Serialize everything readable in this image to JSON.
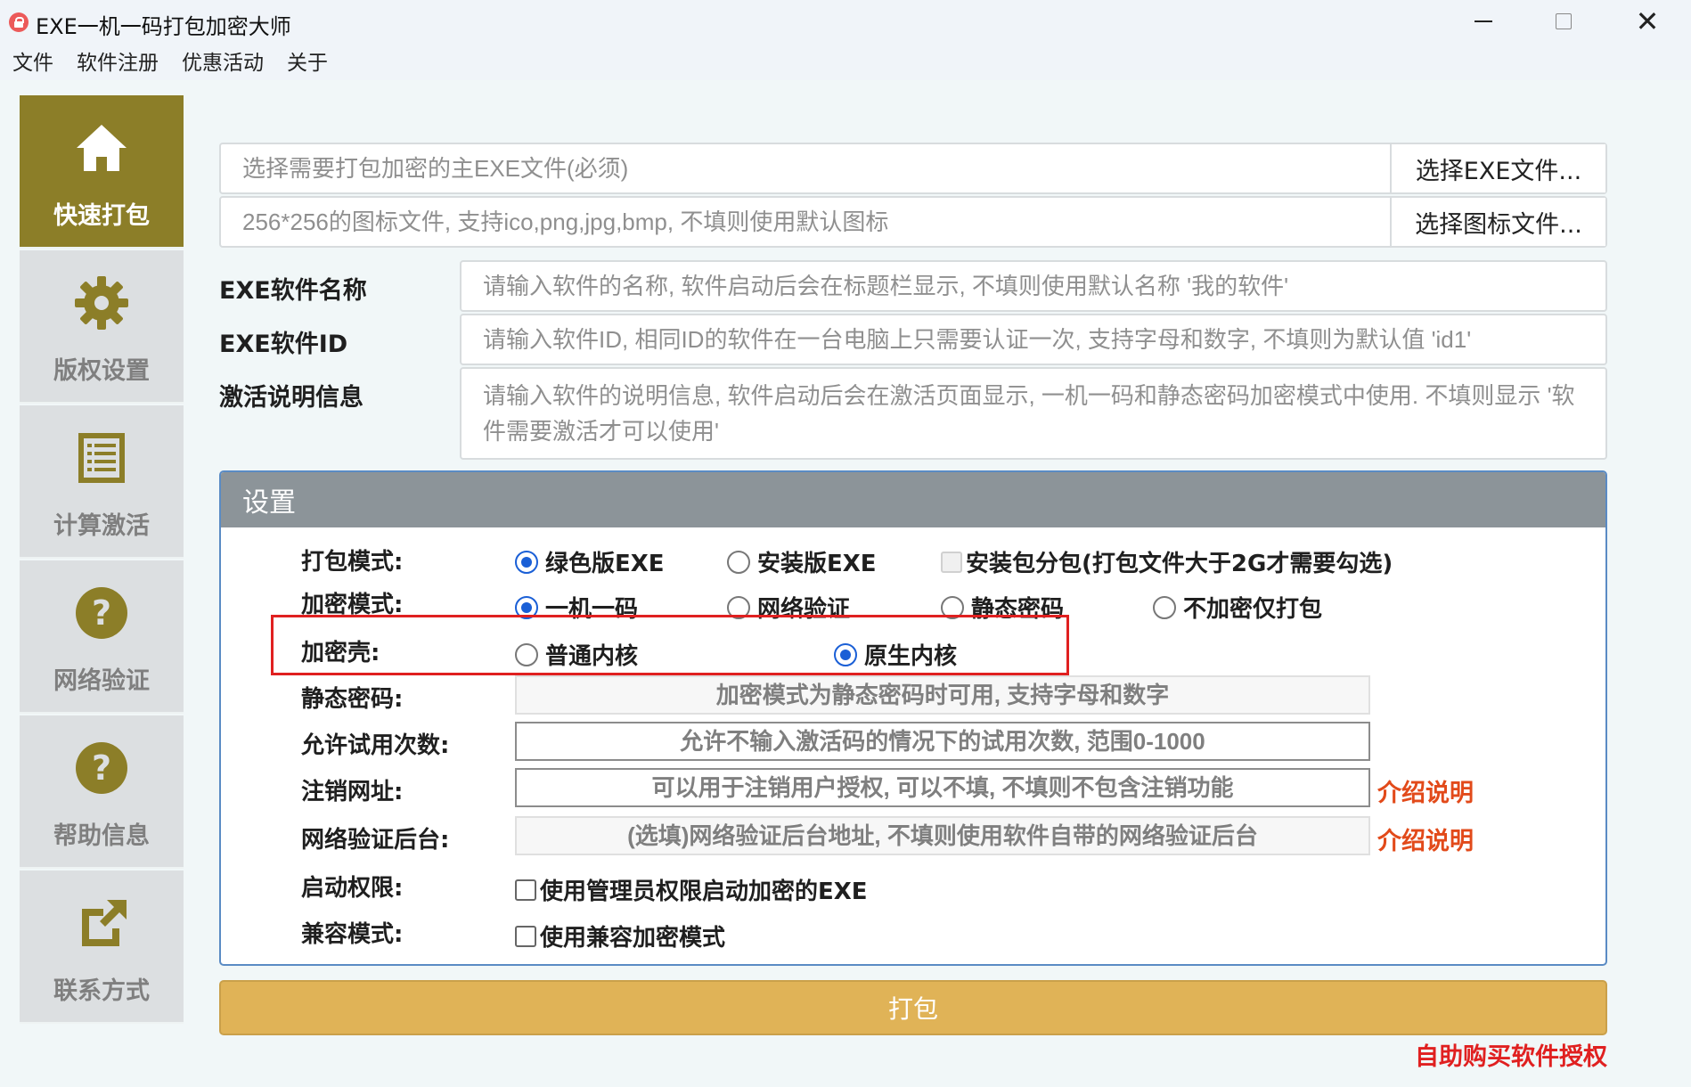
{
  "window": {
    "title": "EXE一机一码打包加密大师",
    "icon": "lock-icon"
  },
  "menu": [
    "文件",
    "软件注册",
    "优惠活动",
    "关于"
  ],
  "sidebar": {
    "items": [
      {
        "label": "快速打包",
        "icon": "home-icon",
        "active": true
      },
      {
        "label": "版权设置",
        "icon": "gear-icon",
        "active": false
      },
      {
        "label": "计算激活",
        "icon": "list-icon",
        "active": false
      },
      {
        "label": "网络验证",
        "icon": "help-circle-icon",
        "active": false
      },
      {
        "label": "帮助信息",
        "icon": "help-circle-icon",
        "active": false
      },
      {
        "label": "联系方式",
        "icon": "share-icon",
        "active": false
      }
    ]
  },
  "form": {
    "exe_file": {
      "placeholder": "选择需要打包加密的主EXE文件(必须)",
      "button": "选择EXE文件..."
    },
    "icon_file": {
      "placeholder": "256*256的图标文件, 支持ico,png,jpg,bmp, 不填则使用默认图标",
      "button": "选择图标文件..."
    },
    "software_name": {
      "label": "EXE软件名称",
      "placeholder": "请输入软件的名称, 软件启动后会在标题栏显示, 不填则使用默认名称 '我的软件'"
    },
    "software_id": {
      "label": "EXE软件ID",
      "placeholder": "请输入软件ID, 相同ID的软件在一台电脑上只需要认证一次, 支持字母和数字, 不填则为默认值 'id1'"
    },
    "activation_info": {
      "label": "激活说明信息",
      "placeholder": "请输入软件的说明信息, 软件启动后会在激活页面显示, 一机一码和静态密码加密模式中使用. 不填则显示 '软件需要激活才可以使用'"
    }
  },
  "settings": {
    "title": "设置",
    "pack_mode": {
      "label": "打包模式:",
      "options": [
        "绿色版EXE",
        "安装版EXE"
      ],
      "selected": "绿色版EXE",
      "split_option": "安装包分包(打包文件大于2G才需要勾选)"
    },
    "encrypt_mode": {
      "label": "加密模式:",
      "options": [
        "一机一码",
        "网络验证",
        "静态密码",
        "不加密仅打包"
      ],
      "selected": "一机一码"
    },
    "shell": {
      "label": "加密壳:",
      "options": [
        "普通内核",
        "原生内核"
      ],
      "selected": "原生内核"
    },
    "static_password": {
      "label": "静态密码:",
      "placeholder": "加密模式为静态密码时可用, 支持字母和数字"
    },
    "trial_count": {
      "label": "允许试用次数:",
      "placeholder": "允许不输入激活码的情况下的试用次数, 范围0-1000"
    },
    "logout_url": {
      "label": "注销网址:",
      "placeholder": "可以用于注销用户授权, 可以不填, 不填则不包含注销功能",
      "link": "介绍说明"
    },
    "network_backend": {
      "label": "网络验证后台:",
      "placeholder": "(选填)网络验证后台地址, 不填则使用软件自带的网络验证后台",
      "link": "介绍说明"
    },
    "launch_permission": {
      "label": "启动权限:",
      "option": "使用管理员权限启动加密的EXE"
    },
    "compat_mode": {
      "label": "兼容模式:",
      "option": "使用兼容加密模式"
    }
  },
  "actions": {
    "pack_button": "打包",
    "buy_link": "自助购买软件授权"
  }
}
